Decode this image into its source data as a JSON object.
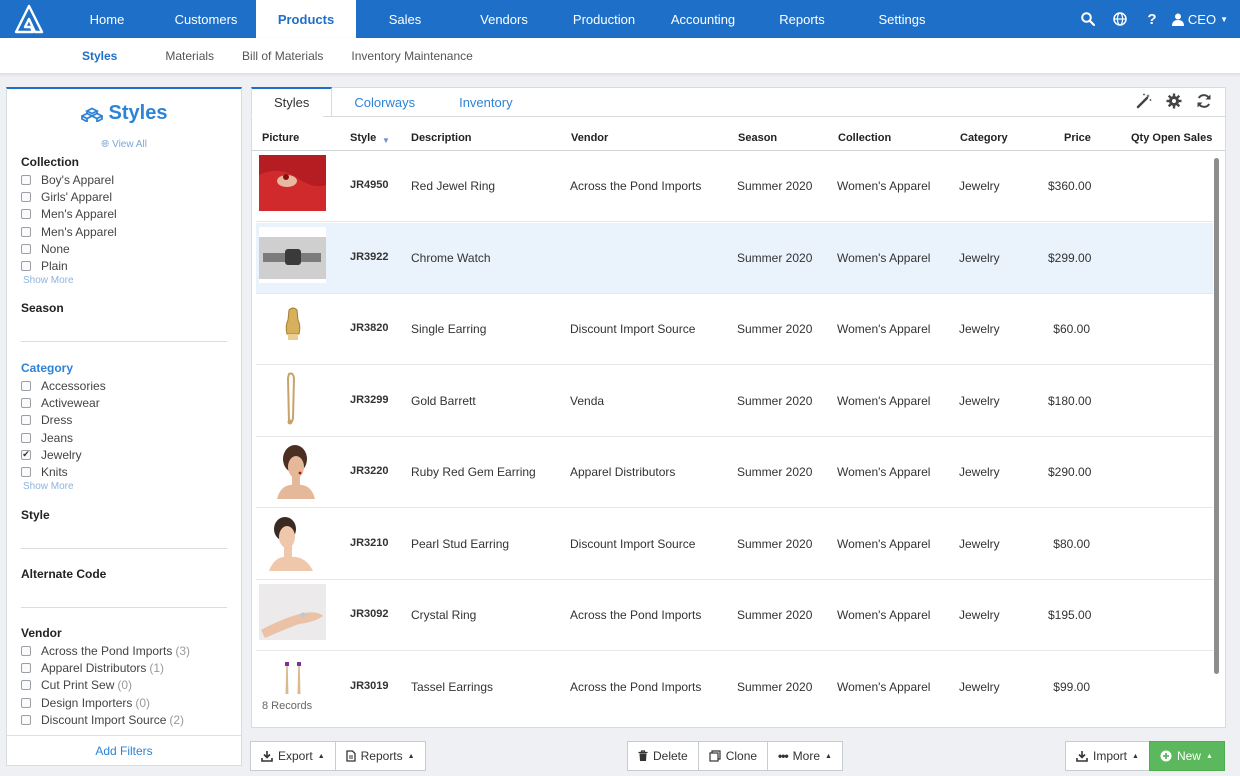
{
  "nav": {
    "items": [
      {
        "label": "Home",
        "active": false
      },
      {
        "label": "Customers",
        "active": false
      },
      {
        "label": "Products",
        "active": true
      },
      {
        "label": "Sales",
        "active": false
      },
      {
        "label": "Vendors",
        "active": false
      },
      {
        "label": "Production",
        "active": false
      },
      {
        "label": "Accounting",
        "active": false
      },
      {
        "label": "Reports",
        "active": false
      },
      {
        "label": "Settings",
        "active": false
      }
    ],
    "user": "CEO"
  },
  "subnav": {
    "items": [
      {
        "label": "Styles",
        "active": true
      },
      {
        "label": "Materials",
        "active": false
      },
      {
        "label": "Bill of Materials",
        "active": false
      },
      {
        "label": "Inventory Maintenance",
        "active": false
      }
    ]
  },
  "sidebar": {
    "title": "Styles",
    "view_all": "View All",
    "collection": {
      "label": "Collection",
      "options": [
        "Boy's Apparel",
        "Girls' Apparel",
        "Men's Apparel",
        "Men's Apparel",
        "None",
        "Plain"
      ],
      "show_more": "Show More"
    },
    "season": {
      "label": "Season"
    },
    "category": {
      "label": "Category",
      "options": [
        "Accessories",
        "Activewear",
        "Dress",
        "Jeans",
        "Jewelry",
        "Knits"
      ],
      "checked": "Jewelry",
      "show_more": "Show More"
    },
    "style": {
      "label": "Style"
    },
    "alternate_code": {
      "label": "Alternate Code"
    },
    "vendor": {
      "label": "Vendor",
      "options": [
        {
          "name": "Across the Pond Imports",
          "count": "(3)"
        },
        {
          "name": "Apparel Distributors",
          "count": "(1)"
        },
        {
          "name": "Cut Print Sew",
          "count": "(0)"
        },
        {
          "name": "Design Importers",
          "count": "(0)"
        },
        {
          "name": "Discount Import Source",
          "count": "(2)"
        }
      ]
    },
    "add_filters": "Add Filters"
  },
  "tabs": [
    "Styles",
    "Colorways",
    "Inventory"
  ],
  "table": {
    "headers": [
      "Picture",
      "Style",
      "Description",
      "Vendor",
      "Season",
      "Collection",
      "Category",
      "Price",
      "Qty Open Sales"
    ],
    "rows": [
      {
        "style": "JR4950",
        "description": "Red Jewel Ring",
        "vendor": "Across the Pond Imports",
        "season": "Summer 2020",
        "collection": "Women's Apparel",
        "category": "Jewelry",
        "price": "$360.00",
        "pic": "red-ring"
      },
      {
        "style": "JR3922",
        "description": "Chrome Watch",
        "vendor": "",
        "season": "Summer 2020",
        "collection": "Women's Apparel",
        "category": "Jewelry",
        "price": "$299.00",
        "pic": "watch"
      },
      {
        "style": "JR3820",
        "description": "Single Earring",
        "vendor": "Discount Import Source",
        "season": "Summer 2020",
        "collection": "Women's Apparel",
        "category": "Jewelry",
        "price": "$60.00",
        "pic": "earring"
      },
      {
        "style": "JR3299",
        "description": "Gold Barrett",
        "vendor": "Venda",
        "season": "Summer 2020",
        "collection": "Women's Apparel",
        "category": "Jewelry",
        "price": "$180.00",
        "pic": "barrett"
      },
      {
        "style": "JR3220",
        "description": "Ruby Red Gem Earring",
        "vendor": "Apparel Distributors",
        "season": "Summer 2020",
        "collection": "Women's Apparel",
        "category": "Jewelry",
        "price": "$290.00",
        "pic": "woman1"
      },
      {
        "style": "JR3210",
        "description": "Pearl Stud Earring",
        "vendor": "Discount Import Source",
        "season": "Summer 2020",
        "collection": "Women's Apparel",
        "category": "Jewelry",
        "price": "$80.00",
        "pic": "woman2"
      },
      {
        "style": "JR3092",
        "description": "Crystal Ring",
        "vendor": "Across the Pond Imports",
        "season": "Summer 2020",
        "collection": "Women's Apparel",
        "category": "Jewelry",
        "price": "$195.00",
        "pic": "hand"
      },
      {
        "style": "JR3019",
        "description": "Tassel Earrings",
        "vendor": "Across the Pond Imports",
        "season": "Summer 2020",
        "collection": "Women's Apparel",
        "category": "Jewelry",
        "price": "$99.00",
        "pic": "tassel"
      }
    ],
    "selected_row": 1,
    "records": "8 Records"
  },
  "toolbar": {
    "export": "Export",
    "reports": "Reports",
    "delete": "Delete",
    "clone": "Clone",
    "more": "More",
    "import": "Import",
    "new": "New"
  },
  "colors": {
    "brand": "#1e6fc8",
    "link": "#2d83d6",
    "new_button": "#5cb85c"
  }
}
